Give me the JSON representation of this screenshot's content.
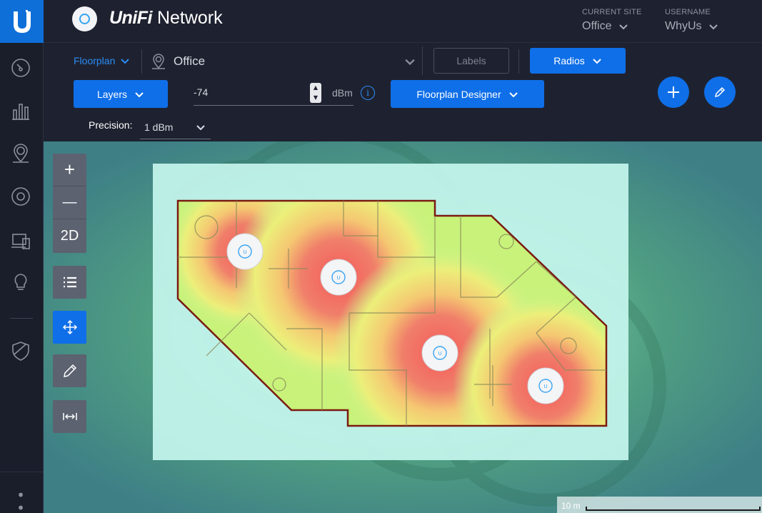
{
  "header": {
    "app_name_brand": "UniFi",
    "app_name_suffix": " Network",
    "site": {
      "label": "CURRENT SITE",
      "value": "Office"
    },
    "user": {
      "label": "USERNAME",
      "value": "WhyUs"
    }
  },
  "sidebar": {
    "items": [
      {
        "name": "dashboard",
        "icon": "dashboard-icon"
      },
      {
        "name": "statistics",
        "icon": "statistics-icon"
      },
      {
        "name": "map",
        "icon": "map-icon"
      },
      {
        "name": "devices",
        "icon": "devices-icon"
      },
      {
        "name": "clients",
        "icon": "clients-icon"
      },
      {
        "name": "insights",
        "icon": "insights-icon"
      },
      {
        "name": "threat-management",
        "icon": "shield-icon"
      }
    ],
    "more": "• • •"
  },
  "toolbar": {
    "floorplan_dropdown": "Floorplan",
    "location_value": "Office",
    "labels_button": "Labels",
    "radios_button": "Radios",
    "layers_button": "Layers",
    "signal_value": "-74",
    "signal_unit": "dBm",
    "designer_button": "Floorplan Designer",
    "precision_label": "Precision:",
    "precision_value": "1 dBm"
  },
  "map": {
    "zoom_in": "+",
    "zoom_out": "—",
    "view_mode": "2D",
    "scale_label": "10 m",
    "access_points": [
      {
        "label": "U"
      },
      {
        "label": "U"
      },
      {
        "label": "U"
      },
      {
        "label": "U"
      }
    ],
    "colors": {
      "outer_field": "#5a9a8a",
      "plan_background": "#c8f5ee",
      "strong_signal": "#f06a6a",
      "mid_signal": "#f5d470",
      "weak_signal": "#c8f27a",
      "wall": "#7a1a12",
      "accent": "#0f6fe8"
    }
  }
}
